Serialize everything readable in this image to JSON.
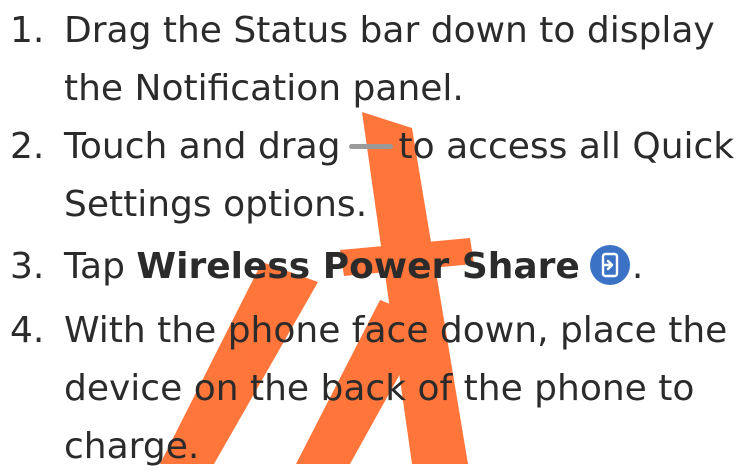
{
  "steps": [
    {
      "number": "1.",
      "line1": "Drag the Status bar down to display",
      "line2": "the Notification panel."
    },
    {
      "number": "2.",
      "line1_a": "Touch and drag",
      "line1_b": "to access all Quick",
      "line2": "Settings options."
    },
    {
      "number": "3.",
      "pre": "Tap ",
      "bold": "Wireless Power Share",
      "post": "."
    },
    {
      "number": "4.",
      "line1": "With the phone face down, place the",
      "line2": "device on the back of the phone to",
      "line3": "charge."
    }
  ],
  "icons": {
    "drag_handle": "drag-handle-icon",
    "wireless_power_share": "wireless-power-share-icon"
  },
  "colors": {
    "text": "#2b2b2b",
    "watermark": "#ff6a2a",
    "icon_blue": "#3b72c5",
    "handle_gray": "#9a9a9a"
  }
}
